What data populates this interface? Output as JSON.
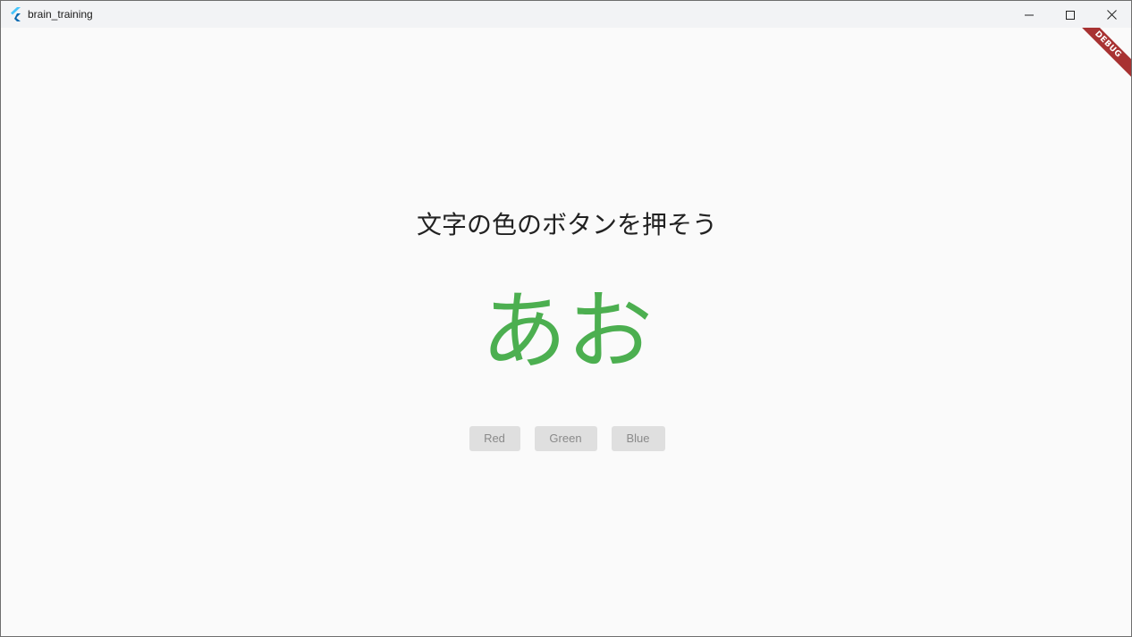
{
  "window": {
    "title": "brain_training",
    "app_icon": "flutter-logo-icon",
    "controls": {
      "minimize_icon": "minimize-icon",
      "maximize_icon": "maximize-icon",
      "close_icon": "close-icon"
    }
  },
  "main": {
    "instruction": "文字の色のボタンを押そう",
    "word": "あお",
    "word_color": "#4caf50",
    "buttons": [
      {
        "label": "Red"
      },
      {
        "label": "Green"
      },
      {
        "label": "Blue"
      }
    ]
  },
  "debug_banner": {
    "label": "DEBUG",
    "color": "#a83232"
  }
}
